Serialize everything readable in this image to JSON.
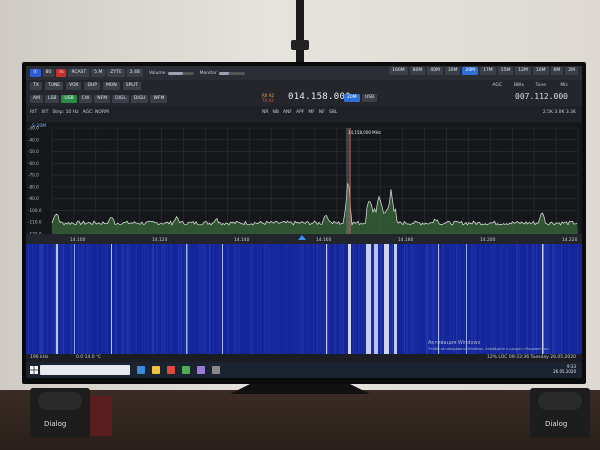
{
  "app": {
    "toolbar_row1": [
      "Ⓢ",
      "80",
      "rs",
      "RCAST",
      "5.M",
      "ZYTE",
      "2.48"
    ],
    "volume_label": "Volume",
    "monitor_label": "Monitor",
    "band_buttons": [
      "160M",
      "80M",
      "40M",
      "30M",
      "20M",
      "17M",
      "15M",
      "12M",
      "10M",
      "6M",
      "2M"
    ],
    "band_selected": "20M",
    "row2_items": [
      "TX",
      "TUNE",
      "VOX",
      "DUP",
      "MON",
      "SPLIT"
    ],
    "modes": [
      "AM",
      "LSB",
      "USB",
      "CW",
      "NFM",
      "DIGL",
      "DIGU",
      "WFM"
    ],
    "mode_selected": "USB",
    "row4_items": [
      "RIT",
      "XIT",
      "Step: 10 Hz",
      "AGC: NORM"
    ],
    "vfo_a": {
      "rx_label": "RX A2",
      "tx_label": "TX A2",
      "frequency": "014.158.000"
    },
    "vfo_b": {
      "frequency": "007.112.000",
      "sub": "2.5K 3.0K 3.3K"
    },
    "toggles": [
      "20M",
      "USB"
    ],
    "dsp_buttons": [
      "NR",
      "NB",
      "ANF",
      "APF",
      "MF",
      "NF",
      "SBL"
    ],
    "right_controls": [
      "AGC",
      "BWx",
      "Tune",
      "Mic"
    ]
  },
  "spectrum": {
    "label": "S-20M",
    "marker_label": "14,158,000 MHz",
    "y_ticks": [
      "-30.0",
      "-40.0",
      "-50.0",
      "-60.0",
      "-70.0",
      "-80.0",
      "-90.0",
      "-100.0",
      "-110.0",
      "-120.0"
    ],
    "x_ticks": [
      "14.100",
      "14.120",
      "14.140",
      "14.160",
      "14.180",
      "14.200",
      "14.220"
    ]
  },
  "status": {
    "left": "196 kHz",
    "mid": "0.0  14.0 ℃",
    "right": "12%  LOC 09:33:36  Tuesday 26.05.2020"
  },
  "taskbar": {
    "search_placeholder": "",
    "time": "9:33",
    "date": "26.05.2020"
  },
  "watermark": {
    "line1": "Активация Windows",
    "line2": "Чтобы активировать Windows, перейдите в раздел «Параметры»."
  },
  "room": {
    "speaker_brand": "Dialog"
  },
  "colors": {
    "accent": "#2f6fd8",
    "active": "#2a8a45",
    "tx": "#c2312c",
    "waterfall_bg": "#15269a",
    "trace": "#e6e6e6",
    "fill": "#3c6e3c"
  }
}
